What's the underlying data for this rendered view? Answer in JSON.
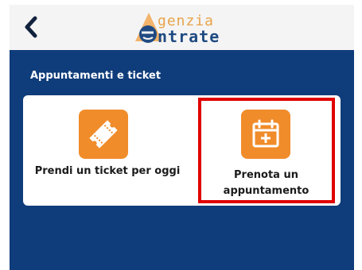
{
  "header": {
    "back_icon": "chevron-left-icon",
    "logo": {
      "line1": "genzia",
      "line2": "ntrate"
    }
  },
  "section": {
    "title": "Appuntamenti e ticket"
  },
  "tiles": [
    {
      "label": "Prendi un ticket per oggi",
      "icon": "ticket-icon"
    },
    {
      "label_line1": "Prenota un",
      "label_line2": "appuntamento",
      "icon": "calendar-add-icon"
    }
  ],
  "colors": {
    "header_bg": "#f4f4f4",
    "page_bg": "#0f3c7a",
    "accent_orange": "#f08c2a",
    "highlight_red": "#e00000",
    "logo_orange": "#e8a44b",
    "logo_blue": "#1f4a82"
  }
}
